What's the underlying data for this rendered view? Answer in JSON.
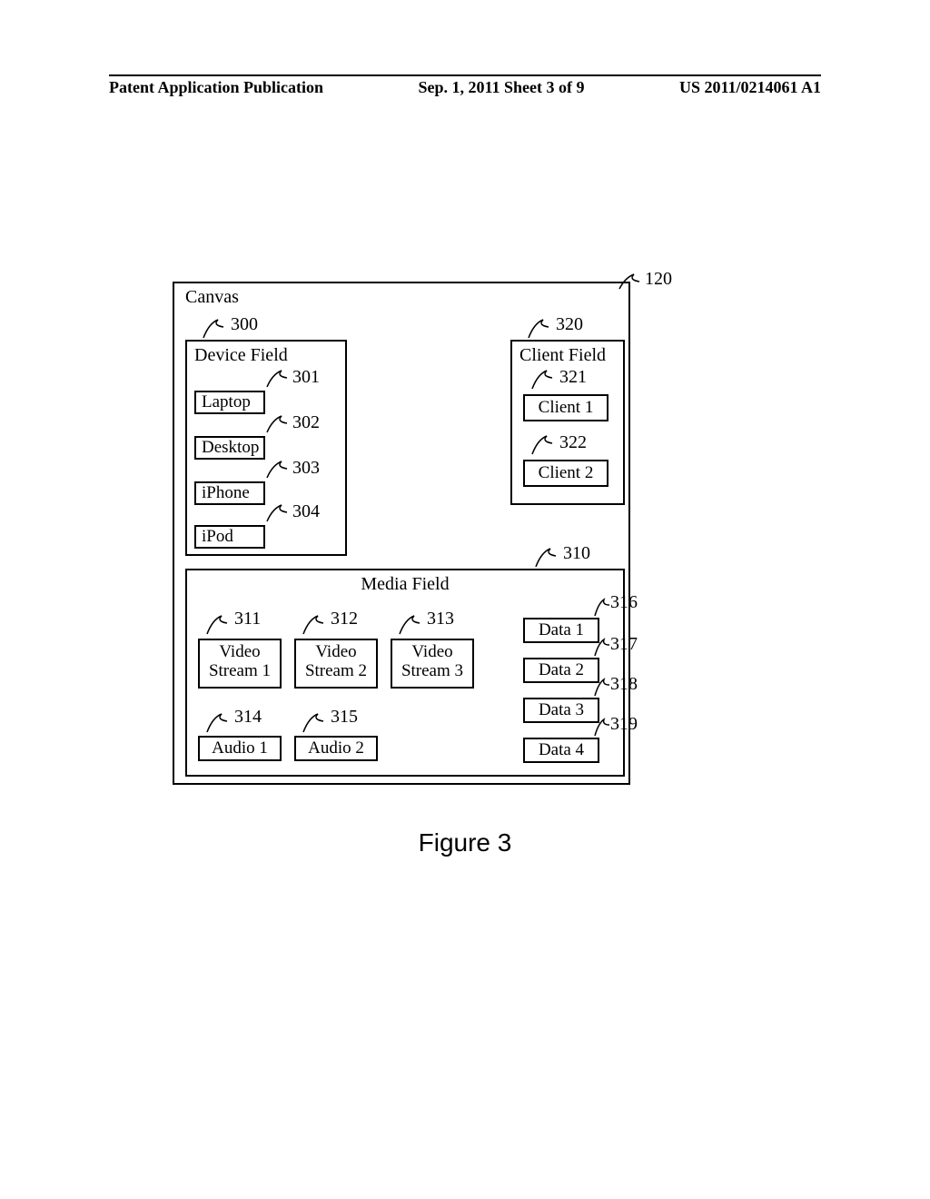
{
  "header": {
    "left": "Patent Application Publication",
    "center": "Sep. 1, 2011   Sheet 3 of 9",
    "right": "US 2011/0214061 A1"
  },
  "refs": {
    "r120": "120",
    "r300": "300",
    "r301": "301",
    "r302": "302",
    "r303": "303",
    "r304": "304",
    "r310": "310",
    "r311": "311",
    "r312": "312",
    "r313": "313",
    "r314": "314",
    "r315": "315",
    "r316": "316",
    "r317": "317",
    "r318": "318",
    "r319": "319",
    "r320": "320",
    "r321": "321",
    "r322": "322"
  },
  "canvas": {
    "label": "Canvas"
  },
  "deviceField": {
    "label": "Device Field",
    "items": [
      "Laptop",
      "Desktop",
      "iPhone",
      "iPod"
    ]
  },
  "clientField": {
    "label": "Client Field",
    "items": [
      "Client 1",
      "Client 2"
    ]
  },
  "mediaField": {
    "label": "Media Field",
    "video": [
      "Video Stream 1",
      "Video Stream 2",
      "Video Stream 3"
    ],
    "audio": [
      "Audio 1",
      "Audio 2"
    ],
    "data": [
      "Data 1",
      "Data 2",
      "Data 3",
      "Data 4"
    ]
  },
  "caption": "Figure 3"
}
